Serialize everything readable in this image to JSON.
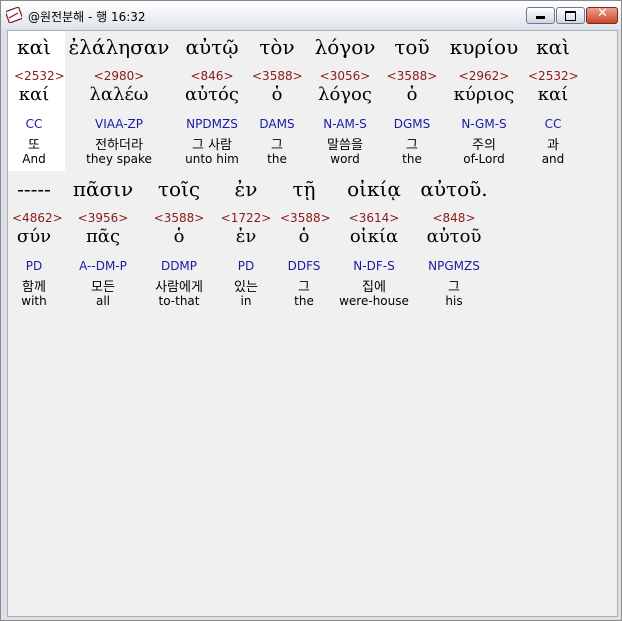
{
  "window": {
    "title": "@원전분해 - 행 16:32"
  },
  "words": [
    {
      "greek": "καὶ",
      "num": "<2532>",
      "lemma": "καί",
      "morph": "CC",
      "ko": "또",
      "en": "And"
    },
    {
      "greek": "ἐλάλησαν",
      "num": "<2980>",
      "lemma": "λαλέω",
      "morph": "VIAA-ZP",
      "ko": "전하더라",
      "en": "they spake"
    },
    {
      "greek": "αὐτῷ",
      "num": "<846>",
      "lemma": "αὐτός",
      "morph": "NPDMZS",
      "ko": "그 사람",
      "en": "unto him"
    },
    {
      "greek": "τὸν",
      "num": "<3588>",
      "lemma": "ὁ",
      "morph": "DAMS",
      "ko": "그",
      "en": "the"
    },
    {
      "greek": "λόγον",
      "num": "<3056>",
      "lemma": "λόγος",
      "morph": "N-AM-S",
      "ko": "말씀을",
      "en": "word"
    },
    {
      "greek": "τοῦ",
      "num": "<3588>",
      "lemma": "ὁ",
      "morph": "DGMS",
      "ko": "그",
      "en": "the"
    },
    {
      "greek": "κυρίου",
      "num": "<2962>",
      "lemma": "κύριος",
      "morph": "N-GM-S",
      "ko": "주의",
      "en": "of-Lord"
    },
    {
      "greek": "καὶ",
      "num": "<2532>",
      "lemma": "καί",
      "morph": "CC",
      "ko": "과",
      "en": "and"
    },
    {
      "greek": "-----",
      "num": "<4862>",
      "lemma": "σύν",
      "morph": "PD",
      "ko": "함께",
      "en": "with"
    },
    {
      "greek": "πᾶσιν",
      "num": "<3956>",
      "lemma": "πᾶς",
      "morph": "A--DM-P",
      "ko": "모든",
      "en": "all"
    },
    {
      "greek": "τοῖς",
      "num": "<3588>",
      "lemma": "ὁ",
      "morph": "DDMP",
      "ko": "사람에게",
      "en": "to-that"
    },
    {
      "greek": "ἐν",
      "num": "<1722>",
      "lemma": "ἐν",
      "morph": "PD",
      "ko": "있는",
      "en": "in"
    },
    {
      "greek": "τῇ",
      "num": "<3588>",
      "lemma": "ὁ",
      "morph": "DDFS",
      "ko": "그",
      "en": "the"
    },
    {
      "greek": "οἰκίᾳ",
      "num": "<3614>",
      "lemma": "οἰκία",
      "morph": "N-DF-S",
      "ko": "집에",
      "en": "were-house"
    },
    {
      "greek": "αὐτοῦ.",
      "num": "<848>",
      "lemma": "αὐτοῦ",
      "morph": "NPGMZS",
      "ko": "그",
      "en": "his"
    }
  ]
}
